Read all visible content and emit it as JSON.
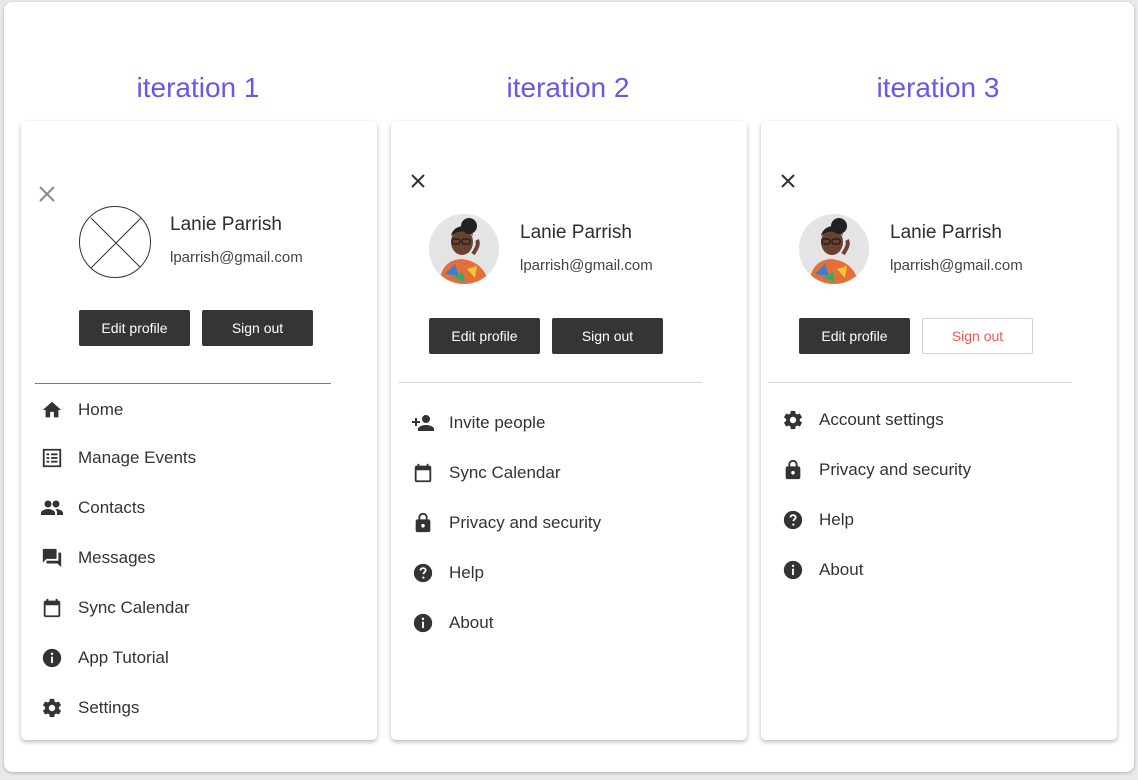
{
  "iterations": [
    {
      "title": "iteration 1",
      "user": {
        "name": "Lanie Parrish",
        "email": "lparrish@gmail.com"
      },
      "edit_label": "Edit profile",
      "signout_label": "Sign out",
      "menu": [
        {
          "icon": "home-icon",
          "label": "Home"
        },
        {
          "icon": "list-icon",
          "label": "Manage Events"
        },
        {
          "icon": "people-icon",
          "label": "Contacts"
        },
        {
          "icon": "chat-icon",
          "label": "Messages"
        },
        {
          "icon": "calendar-icon",
          "label": "Sync Calendar"
        },
        {
          "icon": "info-icon",
          "label": "App Tutorial"
        },
        {
          "icon": "gear-icon",
          "label": "Settings"
        }
      ]
    },
    {
      "title": "iteration 2",
      "user": {
        "name": "Lanie Parrish",
        "email": "lparrish@gmail.com"
      },
      "edit_label": "Edit profile",
      "signout_label": "Sign out",
      "menu": [
        {
          "icon": "person-add-icon",
          "label": "Invite people"
        },
        {
          "icon": "calendar-icon",
          "label": "Sync Calendar"
        },
        {
          "icon": "lock-icon",
          "label": "Privacy and security"
        },
        {
          "icon": "help-icon",
          "label": "Help"
        },
        {
          "icon": "info-icon",
          "label": "About"
        }
      ]
    },
    {
      "title": "iteration 3",
      "user": {
        "name": "Lanie Parrish",
        "email": "lparrish@gmail.com"
      },
      "edit_label": "Edit profile",
      "signout_label": "Sign out",
      "menu": [
        {
          "icon": "gear-icon",
          "label": "Account settings"
        },
        {
          "icon": "lock-icon",
          "label": "Privacy and security"
        },
        {
          "icon": "help-icon",
          "label": "Help"
        },
        {
          "icon": "info-icon",
          "label": "About"
        }
      ]
    }
  ],
  "colors": {
    "title": "#6658e8",
    "button_dark": "#353535",
    "signout_outline_text": "#ec5a4f"
  }
}
